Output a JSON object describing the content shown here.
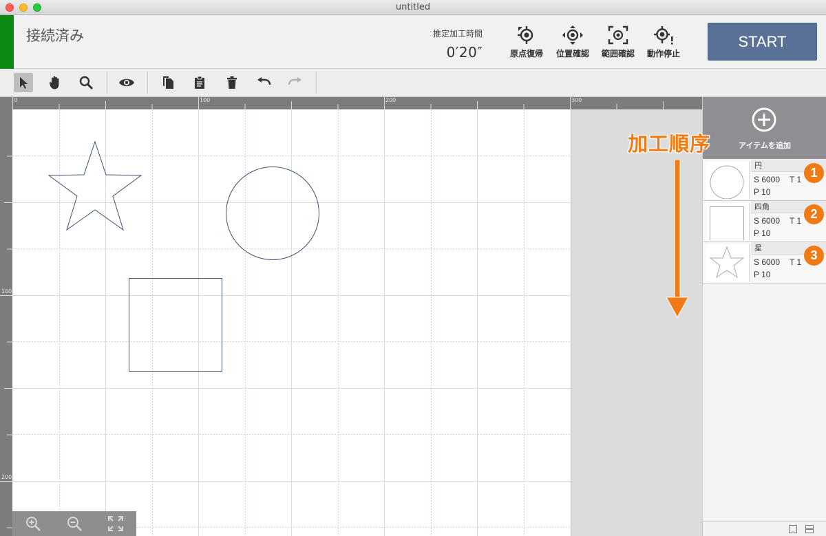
{
  "window": {
    "title": "untitled"
  },
  "header": {
    "status_text": "接続済み",
    "status_color": "#0a8a12",
    "time_label": "推定加工時間",
    "time_value": "0′20″",
    "buttons": [
      {
        "label": "原点復帰",
        "icon": "origin-return-icon"
      },
      {
        "label": "位置確認",
        "icon": "position-check-icon"
      },
      {
        "label": "範囲確認",
        "icon": "range-check-icon"
      },
      {
        "label": "動作停止",
        "icon": "stop-operation-icon"
      }
    ],
    "start_label": "START"
  },
  "toolbar": {
    "tools": [
      "pointer-tool-icon",
      "hand-tool-icon",
      "zoom-tool-icon",
      "preview-eye-icon",
      "copy-icon",
      "paste-icon",
      "delete-icon",
      "undo-icon",
      "redo-icon"
    ]
  },
  "rulers": {
    "top": [
      "0",
      "100",
      "200",
      "300"
    ],
    "left": [
      "100",
      "200"
    ]
  },
  "annotation": {
    "order_label": "加工順序",
    "color": "#f07a13"
  },
  "panel": {
    "add_item_label": "アイテムを追加",
    "items": [
      {
        "name": "円",
        "shape": "circle",
        "s": "S 6000",
        "t": "T 1",
        "p": "P 10",
        "order": "1"
      },
      {
        "name": "四角",
        "shape": "square",
        "s": "S 6000",
        "t": "T 1",
        "p": "P 10",
        "order": "2"
      },
      {
        "name": "星",
        "shape": "star",
        "s": "S 6000",
        "t": "T 1",
        "p": "P 10",
        "order": "3"
      }
    ]
  },
  "colors": {
    "start_button": "#5a7197",
    "shape_stroke": "#3d4f6e",
    "badge": "#f07a13"
  }
}
